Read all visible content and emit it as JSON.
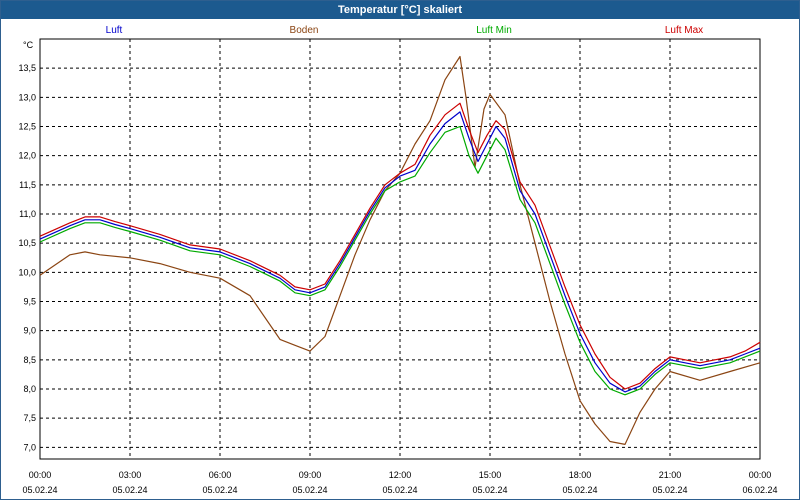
{
  "window": {
    "title": "Temperatur [°C] skaliert"
  },
  "chart_data": {
    "type": "line",
    "title": "Temperatur [°C] skaliert",
    "y_unit": "°C",
    "ylim": [
      6.8,
      14.0
    ],
    "y_ticks": [
      "7,0",
      "7,5",
      "8,0",
      "8,5",
      "9,0",
      "9,5",
      "10,0",
      "10,5",
      "11,0",
      "11,5",
      "12,0",
      "12,5",
      "13,0",
      "13,5"
    ],
    "xlim_hours": [
      0,
      24
    ],
    "x_ticks": [
      {
        "time": "00:00",
        "date": "05.02.24"
      },
      {
        "time": "03:00",
        "date": "05.02.24"
      },
      {
        "time": "06:00",
        "date": "05.02.24"
      },
      {
        "time": "09:00",
        "date": "05.02.24"
      },
      {
        "time": "12:00",
        "date": "05.02.24"
      },
      {
        "time": "15:00",
        "date": "05.02.24"
      },
      {
        "time": "18:00",
        "date": "05.02.24"
      },
      {
        "time": "21:00",
        "date": "05.02.24"
      },
      {
        "time": "00:00",
        "date": "06.02.24"
      }
    ],
    "grid": true,
    "legend_position": "top",
    "series": [
      {
        "name": "Luft",
        "color": "#0000cc",
        "points": [
          [
            0,
            10.57
          ],
          [
            1,
            10.8
          ],
          [
            1.5,
            10.9
          ],
          [
            2,
            10.9
          ],
          [
            2.5,
            10.82
          ],
          [
            3,
            10.75
          ],
          [
            4,
            10.6
          ],
          [
            5,
            10.42
          ],
          [
            6,
            10.35
          ],
          [
            7,
            10.15
          ],
          [
            8,
            9.9
          ],
          [
            8.5,
            9.7
          ],
          [
            9,
            9.65
          ],
          [
            9.5,
            9.75
          ],
          [
            10,
            10.15
          ],
          [
            10.5,
            10.6
          ],
          [
            11,
            11.05
          ],
          [
            11.5,
            11.45
          ],
          [
            12,
            11.65
          ],
          [
            12.5,
            11.75
          ],
          [
            13,
            12.2
          ],
          [
            13.5,
            12.55
          ],
          [
            14,
            12.75
          ],
          [
            14.3,
            12.3
          ],
          [
            14.6,
            11.9
          ],
          [
            14.9,
            12.2
          ],
          [
            15.2,
            12.5
          ],
          [
            15.5,
            12.3
          ],
          [
            16,
            11.4
          ],
          [
            16.5,
            11.0
          ],
          [
            17,
            10.3
          ],
          [
            17.5,
            9.6
          ],
          [
            18,
            8.95
          ],
          [
            18.5,
            8.45
          ],
          [
            19,
            8.1
          ],
          [
            19.5,
            7.95
          ],
          [
            20,
            8.05
          ],
          [
            20.5,
            8.3
          ],
          [
            21,
            8.5
          ],
          [
            21.5,
            8.45
          ],
          [
            22,
            8.4
          ],
          [
            22.5,
            8.45
          ],
          [
            23,
            8.5
          ],
          [
            23.5,
            8.6
          ],
          [
            24,
            8.7
          ]
        ]
      },
      {
        "name": "Boden",
        "color": "#8b4513",
        "points": [
          [
            0,
            9.95
          ],
          [
            1,
            10.3
          ],
          [
            1.5,
            10.35
          ],
          [
            2,
            10.3
          ],
          [
            3,
            10.25
          ],
          [
            4,
            10.15
          ],
          [
            5,
            10.0
          ],
          [
            6,
            9.9
          ],
          [
            7,
            9.6
          ],
          [
            8,
            8.85
          ],
          [
            8.5,
            8.75
          ],
          [
            9,
            8.65
          ],
          [
            9.5,
            8.9
          ],
          [
            10,
            9.6
          ],
          [
            10.5,
            10.3
          ],
          [
            11,
            10.9
          ],
          [
            11.5,
            11.4
          ],
          [
            12,
            11.7
          ],
          [
            12.5,
            12.2
          ],
          [
            13,
            12.6
          ],
          [
            13.5,
            13.3
          ],
          [
            14,
            13.7
          ],
          [
            14.2,
            13.0
          ],
          [
            14.5,
            11.8
          ],
          [
            14.8,
            12.8
          ],
          [
            15,
            13.05
          ],
          [
            15.5,
            12.7
          ],
          [
            16,
            11.5
          ],
          [
            16.5,
            10.5
          ],
          [
            17,
            9.5
          ],
          [
            17.5,
            8.6
          ],
          [
            18,
            7.8
          ],
          [
            18.5,
            7.4
          ],
          [
            19,
            7.1
          ],
          [
            19.5,
            7.05
          ],
          [
            20,
            7.6
          ],
          [
            20.5,
            8.0
          ],
          [
            21,
            8.3
          ],
          [
            22,
            8.15
          ],
          [
            23,
            8.3
          ],
          [
            24,
            8.45
          ]
        ]
      },
      {
        "name": "Luft Min",
        "color": "#00aa00",
        "points": [
          [
            0,
            10.52
          ],
          [
            1,
            10.75
          ],
          [
            1.5,
            10.85
          ],
          [
            2,
            10.85
          ],
          [
            2.5,
            10.77
          ],
          [
            3,
            10.7
          ],
          [
            4,
            10.55
          ],
          [
            5,
            10.37
          ],
          [
            6,
            10.3
          ],
          [
            7,
            10.1
          ],
          [
            8,
            9.85
          ],
          [
            8.5,
            9.65
          ],
          [
            9,
            9.6
          ],
          [
            9.5,
            9.7
          ],
          [
            10,
            10.1
          ],
          [
            10.5,
            10.55
          ],
          [
            11,
            11.0
          ],
          [
            11.5,
            11.4
          ],
          [
            12,
            11.55
          ],
          [
            12.5,
            11.65
          ],
          [
            13,
            12.05
          ],
          [
            13.5,
            12.4
          ],
          [
            14,
            12.5
          ],
          [
            14.3,
            12.0
          ],
          [
            14.6,
            11.7
          ],
          [
            14.9,
            12.0
          ],
          [
            15.2,
            12.3
          ],
          [
            15.5,
            12.1
          ],
          [
            16,
            11.25
          ],
          [
            16.5,
            10.85
          ],
          [
            17,
            10.15
          ],
          [
            17.5,
            9.45
          ],
          [
            18,
            8.8
          ],
          [
            18.5,
            8.3
          ],
          [
            19,
            8.0
          ],
          [
            19.5,
            7.9
          ],
          [
            20,
            8.0
          ],
          [
            20.5,
            8.25
          ],
          [
            21,
            8.45
          ],
          [
            21.5,
            8.4
          ],
          [
            22,
            8.35
          ],
          [
            22.5,
            8.4
          ],
          [
            23,
            8.45
          ],
          [
            23.5,
            8.55
          ],
          [
            24,
            8.65
          ]
        ]
      },
      {
        "name": "Luft Max",
        "color": "#cc0000",
        "points": [
          [
            0,
            10.62
          ],
          [
            1,
            10.85
          ],
          [
            1.5,
            10.95
          ],
          [
            2,
            10.95
          ],
          [
            2.5,
            10.87
          ],
          [
            3,
            10.8
          ],
          [
            4,
            10.65
          ],
          [
            5,
            10.47
          ],
          [
            6,
            10.4
          ],
          [
            7,
            10.2
          ],
          [
            8,
            9.95
          ],
          [
            8.5,
            9.75
          ],
          [
            9,
            9.7
          ],
          [
            9.5,
            9.8
          ],
          [
            10,
            10.2
          ],
          [
            10.5,
            10.65
          ],
          [
            11,
            11.1
          ],
          [
            11.5,
            11.5
          ],
          [
            12,
            11.7
          ],
          [
            12.5,
            11.85
          ],
          [
            13,
            12.35
          ],
          [
            13.5,
            12.7
          ],
          [
            14,
            12.9
          ],
          [
            14.3,
            12.45
          ],
          [
            14.6,
            12.05
          ],
          [
            14.9,
            12.35
          ],
          [
            15.2,
            12.6
          ],
          [
            15.5,
            12.45
          ],
          [
            16,
            11.55
          ],
          [
            16.5,
            11.15
          ],
          [
            17,
            10.45
          ],
          [
            17.5,
            9.75
          ],
          [
            18,
            9.1
          ],
          [
            18.5,
            8.6
          ],
          [
            19,
            8.2
          ],
          [
            19.5,
            8.0
          ],
          [
            20,
            8.1
          ],
          [
            20.5,
            8.35
          ],
          [
            21,
            8.55
          ],
          [
            21.5,
            8.5
          ],
          [
            22,
            8.45
          ],
          [
            22.5,
            8.5
          ],
          [
            23,
            8.55
          ],
          [
            23.5,
            8.65
          ],
          [
            24,
            8.8
          ]
        ]
      }
    ]
  }
}
